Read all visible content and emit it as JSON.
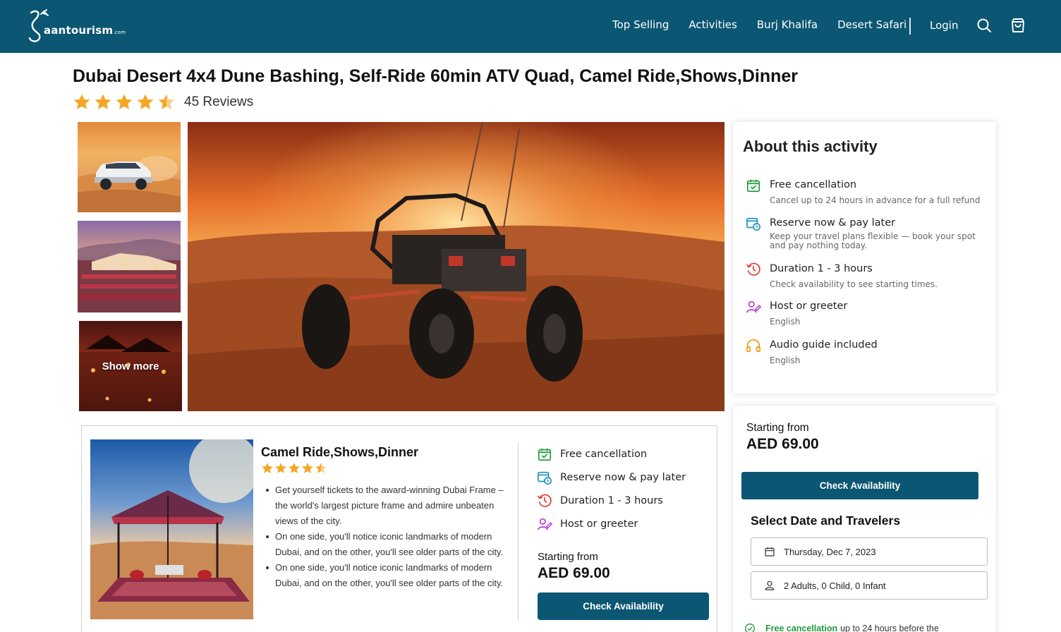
{
  "brand": {
    "logo_text": "aantourism",
    "logo_suffix": ".com",
    "nav_bg": "#0b5672"
  },
  "nav": {
    "links": [
      "Top Selling",
      "Activities",
      "Burj Khalifa",
      "Desert Safari"
    ],
    "login": "Login",
    "icons": [
      "search-icon",
      "cart-icon"
    ]
  },
  "product": {
    "title": "Dubai Desert 4x4 Dune Bashing, Self-Ride 60min ATV Quad, Camel Ride,Shows,Dinner",
    "rating": 4.5,
    "reviews_label": "45 Reviews"
  },
  "gallery": {
    "show_more": "Show more"
  },
  "about": {
    "title": "About this activity",
    "items": [
      {
        "icon": "calendar-check-icon",
        "title": "Free cancellation",
        "sub": "Cancel up to 24 hours in advance for a full refund"
      },
      {
        "icon": "calendar-clock-icon",
        "title": "Reserve now & pay later",
        "sub": "Keep your travel plans flexible — book your spot and pay nothing today."
      },
      {
        "icon": "clock-icon",
        "title": "Duration 1 - 3 hours",
        "sub": "Check availability to see starting times."
      },
      {
        "icon": "host-icon",
        "title": "Host or greeter",
        "sub": "English"
      },
      {
        "icon": "headphones-icon",
        "title": "Audio guide included",
        "sub": "English"
      }
    ]
  },
  "package": {
    "name": "Camel Ride,Shows,Dinner",
    "rating": 4.5,
    "bullets": [
      "Get yourself tickets to the award-winning Dubai Frame – the world's largest picture frame and admire unbeaten views of the city.",
      "On one side, you'll notice iconic landmarks of modern Dubai, and on the other, you'll see older parts of the city.",
      "On one side, you'll notice iconic landmarks of modern Dubai, and on the other, you'll see older parts of the city."
    ],
    "features": [
      "Free cancellation",
      "Reserve now & pay later",
      "Duration 1 - 3 hours",
      "Host or greeter"
    ],
    "starting_label": "Starting from",
    "price": "AED 69.00",
    "cta": "Check Availability"
  },
  "booking": {
    "starting_label": "Starting from",
    "price": "AED 69.00",
    "cta": "Check Availability",
    "heading": "Select Date and Travelers",
    "date_value": "Thursday, Dec 7, 2023",
    "travelers_value": "2 Adults, 0 Child, 0 Infant",
    "free_strong": "Free cancellation",
    "free_rest": "up to 24 hours before the"
  },
  "colors": {
    "primary": "#0b5672",
    "star": "#f5a623",
    "green": "#1e9a3a",
    "blue_icon": "#1f8fbf",
    "red_icon": "#e53935",
    "purple_icon": "#b63ad6",
    "orange_icon": "#f39c12"
  }
}
